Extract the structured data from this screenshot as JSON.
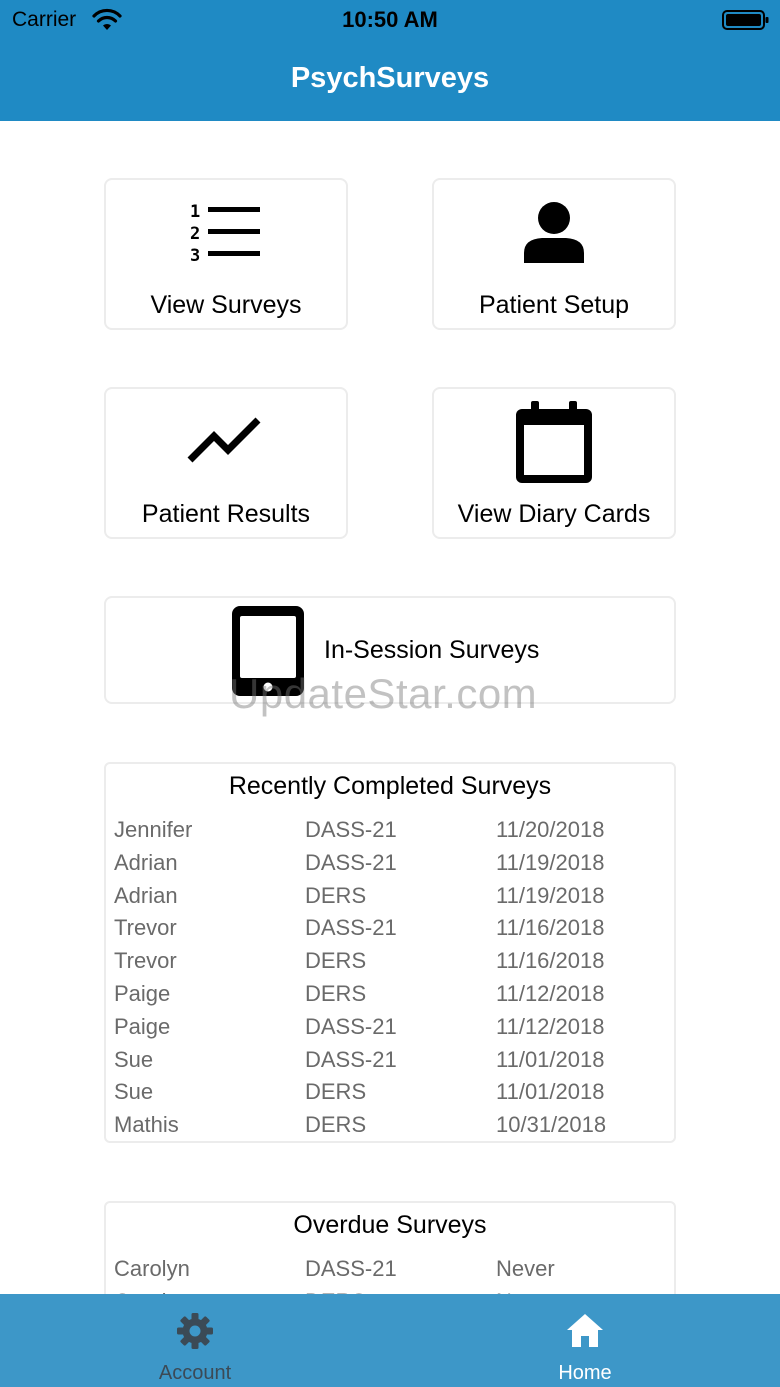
{
  "status_bar": {
    "carrier": "Carrier",
    "time": "10:50 AM"
  },
  "nav": {
    "title": "PsychSurveys"
  },
  "tiles": {
    "view_surveys": "View Surveys",
    "patient_setup": "Patient Setup",
    "patient_results": "Patient Results",
    "view_diary_cards": "View Diary Cards",
    "in_session_surveys": "In-Session Surveys"
  },
  "watermark": "UpdateStar.com",
  "recent": {
    "title": "Recently Completed Surveys",
    "rows": [
      {
        "name": "Jennifer",
        "survey": "DASS-21",
        "date": "11/20/2018"
      },
      {
        "name": "Adrian",
        "survey": "DASS-21",
        "date": "11/19/2018"
      },
      {
        "name": "Adrian",
        "survey": "DERS",
        "date": "11/19/2018"
      },
      {
        "name": "Trevor",
        "survey": "DASS-21",
        "date": "11/16/2018"
      },
      {
        "name": "Trevor",
        "survey": "DERS",
        "date": "11/16/2018"
      },
      {
        "name": "Paige",
        "survey": "DERS",
        "date": "11/12/2018"
      },
      {
        "name": "Paige",
        "survey": "DASS-21",
        "date": "11/12/2018"
      },
      {
        "name": "Sue",
        "survey": "DASS-21",
        "date": "11/01/2018"
      },
      {
        "name": "Sue",
        "survey": "DERS",
        "date": "11/01/2018"
      },
      {
        "name": "Mathis",
        "survey": "DERS",
        "date": "10/31/2018"
      }
    ]
  },
  "overdue": {
    "title": "Overdue Surveys",
    "rows": [
      {
        "name": "Carolyn",
        "survey": "DASS-21",
        "date": "Never"
      },
      {
        "name": "Carolyn",
        "survey": "DERS",
        "date": "Never"
      }
    ]
  },
  "tabbar": {
    "account": {
      "label": "Account",
      "color": "#3b4a56"
    },
    "home": {
      "label": "Home",
      "color": "#ffffff"
    }
  },
  "colors": {
    "nav_bg": "#1f8ac4",
    "tabbar_bg": "#3d97c8",
    "row_text": "#6a6a6a"
  },
  "icons": {
    "view_surveys": "numbered-list-icon",
    "patient_setup": "person-icon",
    "patient_results": "trend-line-icon",
    "view_diary_cards": "calendar-icon",
    "in_session_surveys": "tablet-icon",
    "account": "gear-icon",
    "home": "home-icon"
  }
}
